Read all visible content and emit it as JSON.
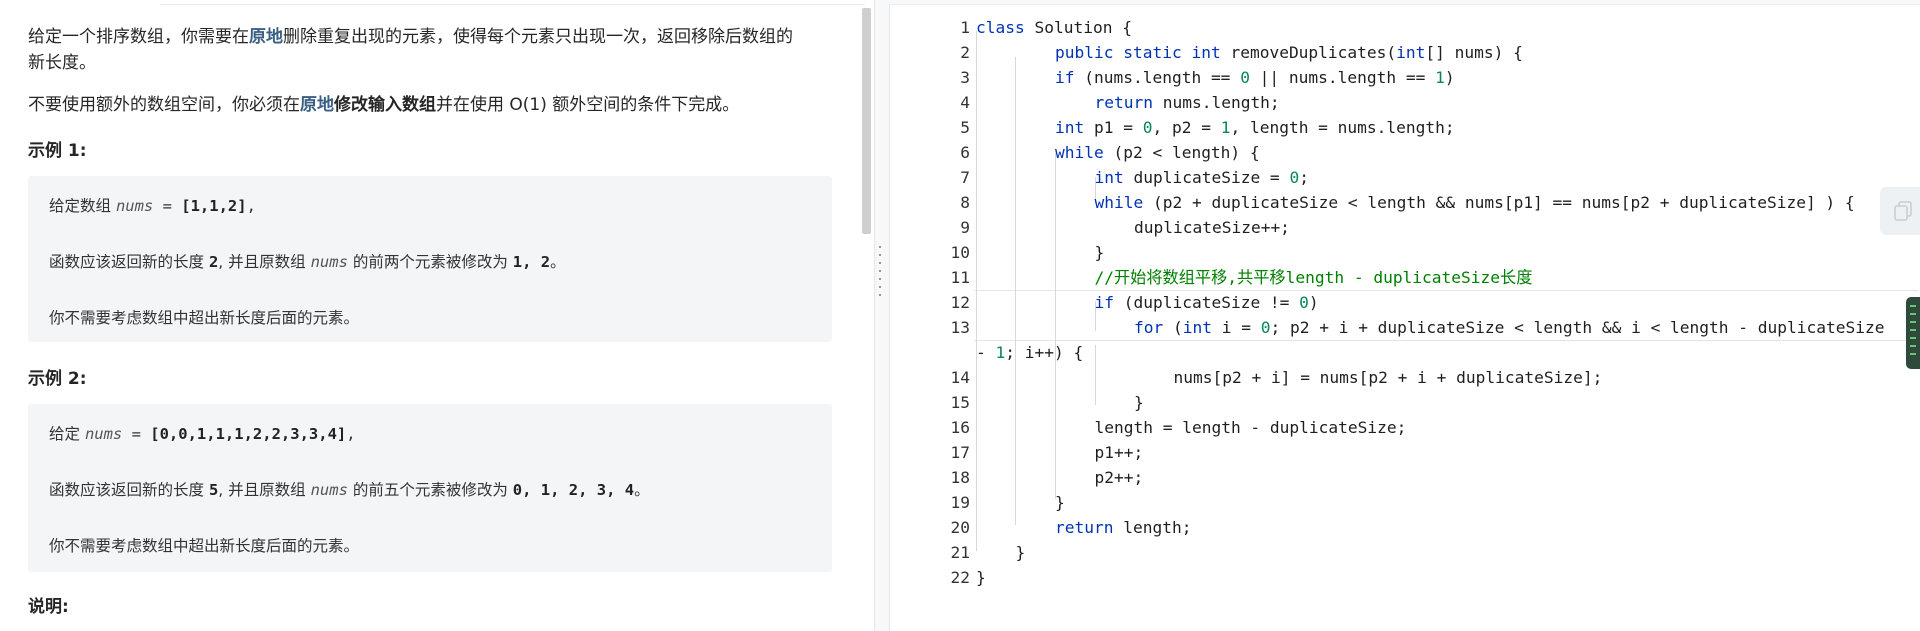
{
  "problem": {
    "para1_pre": "给定一个排序数组，你需要在",
    "para1_hl": "原地",
    "para1_post": "删除重复出现的元素，使得每个元素只出现一次，返回移除后数组的",
    "para1_line2": "新长度。",
    "para2_pre": "不要使用额外的数组空间，你必须在",
    "para2_hl": "原地",
    "para2_bold": "修改输入数组",
    "para2_post": "并在使用 O(1) 额外空间的条件下完成。",
    "example1_title": "示例 1:",
    "example2_title": "示例 2:",
    "explain_title": "说明:",
    "example1": {
      "l1_pre": "给定数组 ",
      "l1_var": "nums",
      "l1_eq": " = ",
      "l1_val": "[1,1,2]",
      "l1_end": ",",
      "l2_pre": "函数应该返回新的长度 ",
      "l2_len": "2",
      "l2_mid": ", 并且原数组 ",
      "l2_var": "nums",
      "l2_mid2": " 的前两个元素被修改为 ",
      "l2_vals": "1, 2",
      "l2_end": "。",
      "l3": "你不需要考虑数组中超出新长度后面的元素。"
    },
    "example2": {
      "l1_pre": "给定 ",
      "l1_var": "nums",
      "l1_eq": " = ",
      "l1_val": "[0,0,1,1,1,2,2,3,3,4]",
      "l1_end": ",",
      "l2_pre": "函数应该返回新的长度 ",
      "l2_len": "5",
      "l2_mid": ", 并且原数组 ",
      "l2_var": "nums",
      "l2_mid2": " 的前五个元素被修改为 ",
      "l2_vals": "0, 1, 2, 3, 4",
      "l2_end": "。",
      "l3": "你不需要考虑数组中超出新长度后面的元素。"
    }
  },
  "editor": {
    "line_numbers": [
      "1",
      "2",
      "3",
      "4",
      "5",
      "6",
      "7",
      "8",
      "9",
      "10",
      "11",
      "12",
      "13",
      "14",
      "15",
      "16",
      "17",
      "18",
      "19",
      "20",
      "21",
      "22"
    ],
    "lines": [
      {
        "t": "class Solution {"
      },
      {
        "t": "public static int removeDuplicates(int[] nums) {"
      },
      {
        "t": "if (nums.length == 0 || nums.length == 1)"
      },
      {
        "t": "return nums.length;"
      },
      {
        "t": "int p1 = 0, p2 = 1, length = nums.length;"
      },
      {
        "t": "while (p2 < length) {"
      },
      {
        "t": "int duplicateSize = 0;"
      },
      {
        "t": "while (p2 + duplicateSize < length && nums[p1] == nums[p2 + duplicateSize] ) {"
      },
      {
        "t": "duplicateSize++;"
      },
      {
        "t": "}"
      },
      {
        "t": "//开始将数组平移,共平移length - duplicateSize长度"
      },
      {
        "t": "if (duplicateSize != 0)"
      },
      {
        "t": "for (int i = 0; p2 + i + duplicateSize < length && i < length - duplicateSize"
      },
      {
        "t": "- 1; i++) {"
      },
      {
        "t": "nums[p2 + i] = nums[p2 + i + duplicateSize];"
      },
      {
        "t": "}"
      },
      {
        "t": "length = length - duplicateSize;"
      },
      {
        "t": "p1++;"
      },
      {
        "t": "p2++;"
      },
      {
        "t": "}"
      },
      {
        "t": "return length;"
      },
      {
        "t": "}"
      },
      {
        "t": "}"
      }
    ]
  },
  "icons": {
    "side_tab": "copy-icon",
    "minimap": "minimap-icon"
  },
  "colors": {
    "keyword": "#0033b3",
    "number": "#098658",
    "comment": "#008000",
    "highlight": "#3b5f84"
  }
}
